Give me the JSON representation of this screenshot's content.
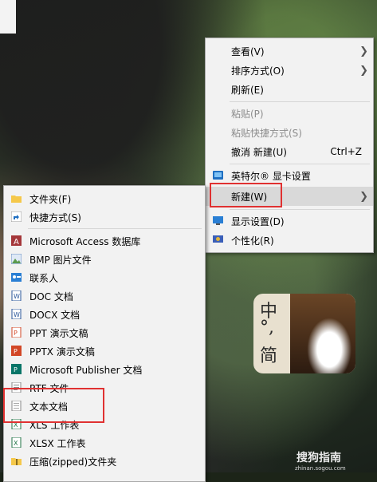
{
  "main_menu": {
    "items": [
      {
        "label": "查看(V)",
        "has_submenu": true
      },
      {
        "label": "排序方式(O)",
        "has_submenu": true
      },
      {
        "label": "刷新(E)"
      },
      {
        "label": "粘贴(P)",
        "disabled": true
      },
      {
        "label": "粘贴快捷方式(S)",
        "disabled": true
      },
      {
        "label": "撤消 新建(U)",
        "shortcut": "Ctrl+Z"
      },
      {
        "label": "英特尔® 显卡设置",
        "icon": "intel-graphics-icon"
      },
      {
        "label": "新建(W)",
        "has_submenu": true,
        "highlighted": true
      },
      {
        "label": "显示设置(D)",
        "icon": "display-settings-icon"
      },
      {
        "label": "个性化(R)",
        "icon": "personalize-icon"
      }
    ]
  },
  "new_submenu": {
    "items": [
      {
        "label": "文件夹(F)",
        "icon": "folder-icon"
      },
      {
        "label": "快捷方式(S)",
        "icon": "shortcut-icon"
      },
      {
        "label": "Microsoft Access 数据库",
        "icon": "access-icon"
      },
      {
        "label": "BMP 图片文件",
        "icon": "bmp-icon"
      },
      {
        "label": "联系人",
        "icon": "contact-icon"
      },
      {
        "label": "DOC 文档",
        "icon": "doc-icon"
      },
      {
        "label": "DOCX 文档",
        "icon": "docx-icon"
      },
      {
        "label": "PPT 演示文稿",
        "icon": "ppt-icon"
      },
      {
        "label": "PPTX 演示文稿",
        "icon": "pptx-icon"
      },
      {
        "label": "Microsoft Publisher 文档",
        "icon": "publisher-icon"
      },
      {
        "label": "RTF 文件",
        "icon": "rtf-icon"
      },
      {
        "label": "文本文档",
        "icon": "text-document-icon",
        "highlighted_box": true
      },
      {
        "label": "XLS 工作表",
        "icon": "xls-icon"
      },
      {
        "label": "XLSX 工作表",
        "icon": "xlsx-icon"
      },
      {
        "label": "压缩(zipped)文件夹",
        "icon": "zip-folder-icon"
      }
    ]
  },
  "overlay": {
    "card_chars": [
      "中",
      "°,",
      "简"
    ],
    "watermark": "搜狗指南",
    "watermark_url": "zhinan.sogou.com"
  },
  "colors": {
    "menu_bg": "#f2f2f2",
    "highlight_box": "#e03131",
    "hover_bg": "#d9d9d9"
  }
}
